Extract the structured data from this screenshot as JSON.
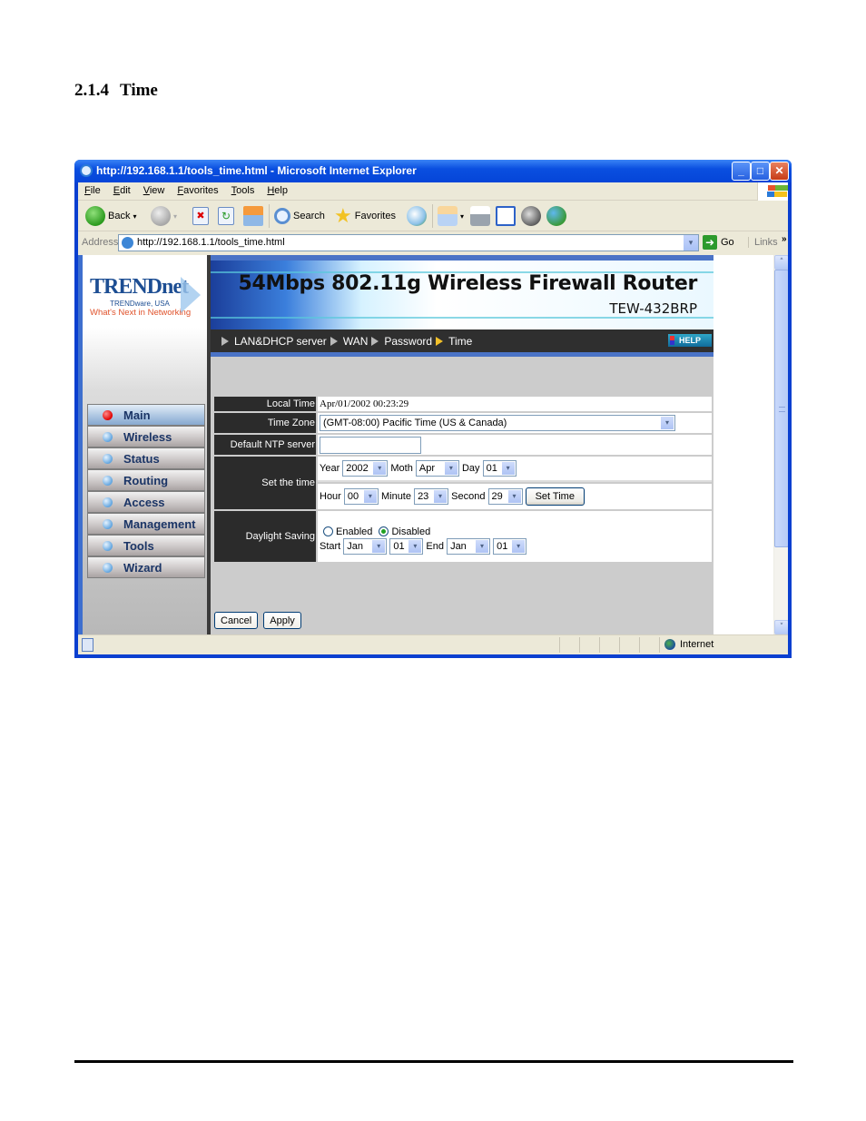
{
  "document": {
    "section_number": "2.1.4",
    "section_title": "Time"
  },
  "browser": {
    "title": "http://192.168.1.1/tools_time.html - Microsoft Internet Explorer",
    "window_buttons": {
      "minimize": "_",
      "maximize": "□",
      "close": "✕"
    },
    "menu": [
      "File",
      "Edit",
      "View",
      "Favorites",
      "Tools",
      "Help"
    ],
    "toolbar": {
      "back": "Back",
      "search": "Search",
      "favorites": "Favorites"
    },
    "address_label": "Address",
    "address_value": "http://192.168.1.1/tools_time.html",
    "go_label": "Go",
    "links_label": "Links",
    "links_more": "»",
    "status_zone": "Internet",
    "dropdown_glyph": "▾",
    "scroll_up": "˄",
    "scroll_down": "˅"
  },
  "router": {
    "logo": {
      "brand": "TRENDnet",
      "sub": "TRENDware, USA",
      "tagline": "What's Next in Networking"
    },
    "banner": {
      "title": "54Mbps 802.11g Wireless Firewall Router",
      "model": "TEW-432BRP"
    },
    "nav": [
      {
        "label": "Main",
        "active": true
      },
      {
        "label": "Wireless",
        "active": false
      },
      {
        "label": "Status",
        "active": false
      },
      {
        "label": "Routing",
        "active": false
      },
      {
        "label": "Access",
        "active": false
      },
      {
        "label": "Management",
        "active": false
      },
      {
        "label": "Tools",
        "active": false
      },
      {
        "label": "Wizard",
        "active": false
      }
    ],
    "subnav": [
      {
        "label": "LAN&DHCP server",
        "current": false
      },
      {
        "label": "WAN",
        "current": false
      },
      {
        "label": "Password",
        "current": false
      },
      {
        "label": "Time",
        "current": true
      }
    ],
    "help_label": "HELP",
    "form": {
      "local_time_label": "Local Time",
      "local_time_value": "Apr/01/2002 00:23:29",
      "time_zone_label": "Time Zone",
      "time_zone_value": "(GMT-08:00) Pacific Time (US & Canada)",
      "ntp_label": "Default NTP server",
      "ntp_value": "",
      "set_time_label": "Set the time",
      "year_label": "Year",
      "year_value": "2002",
      "month_label": "Moth",
      "month_value": "Apr",
      "day_label": "Day",
      "day_value": "01",
      "hour_label": "Hour",
      "hour_value": "00",
      "minute_label": "Minute",
      "minute_value": "23",
      "second_label": "Second",
      "second_value": "29",
      "set_time_button": "Set Time",
      "daylight_label": "Daylight Saving",
      "enabled_label": "Enabled",
      "disabled_label": "Disabled",
      "daylight_selected": "Disabled",
      "start_label": "Start",
      "start_month": "Jan",
      "start_day": "01",
      "end_label": "End",
      "end_month": "Jan",
      "end_day": "01"
    },
    "cancel_label": "Cancel",
    "apply_label": "Apply"
  }
}
